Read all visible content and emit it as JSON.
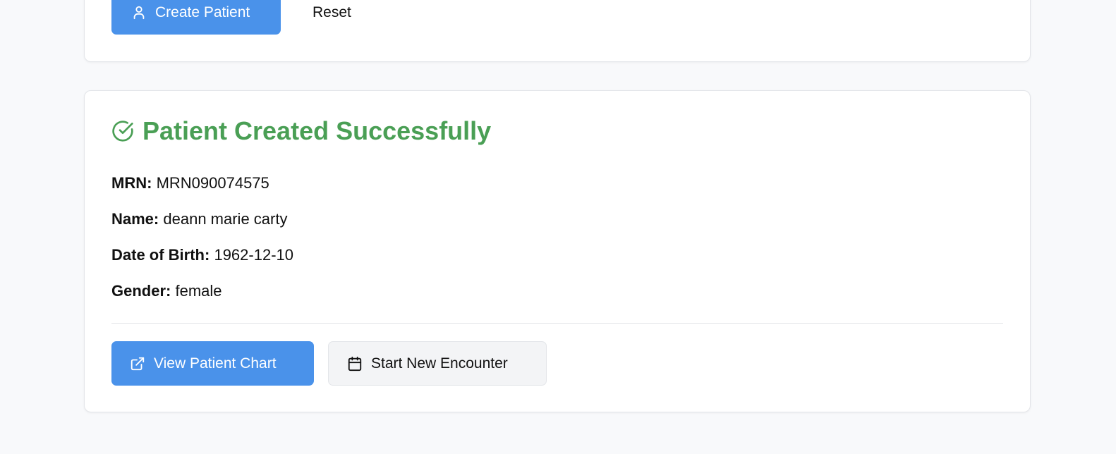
{
  "form": {
    "create_label": "Create Patient",
    "reset_label": "Reset"
  },
  "result": {
    "title": "Patient Created Successfully",
    "fields": [
      {
        "label": "MRN:",
        "value": "MRN090074575"
      },
      {
        "label": "Name:",
        "value": "deann marie carty"
      },
      {
        "label": "Date of Birth:",
        "value": "1962-12-10"
      },
      {
        "label": "Gender:",
        "value": "female"
      }
    ],
    "view_chart_label": "View Patient Chart",
    "new_encounter_label": "Start New Encounter"
  },
  "colors": {
    "primary": "#4a92ea",
    "success": "#4a9f55",
    "background": "#f8f9fb"
  }
}
